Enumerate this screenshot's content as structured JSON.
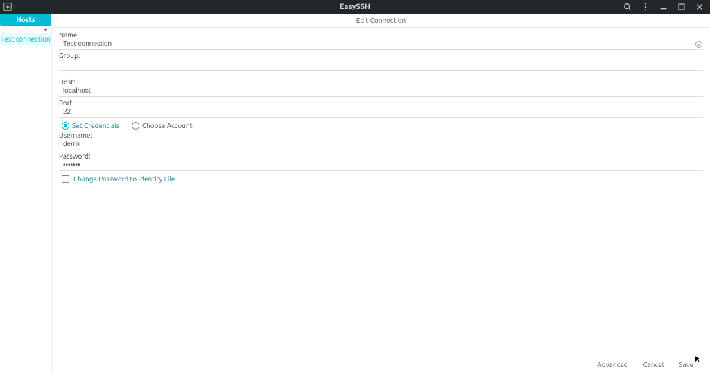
{
  "window": {
    "title": "EasySSH"
  },
  "subtitleBar": {
    "text": "Edit Connection"
  },
  "sidebar": {
    "hosts_label": "Hosts",
    "connection_item": "Test-connection"
  },
  "form": {
    "name_label": "Name:",
    "name_value": "Test-connection",
    "group_label": "Group:",
    "group_value": "",
    "host_label": "Host:",
    "host_value": "localhost",
    "port_label": "Port:",
    "port_value": "22",
    "radio_set_credentials": "Set Credentials",
    "radio_choose_account": "Choose Account",
    "username_label": "Username:",
    "username_value": "derrik",
    "password_label": "Password:",
    "password_value": "•••••••",
    "checkbox_identity": "Change Password to Identity File"
  },
  "buttons": {
    "advanced": "Advanced",
    "cancel": "Cancel",
    "save": "Save"
  }
}
